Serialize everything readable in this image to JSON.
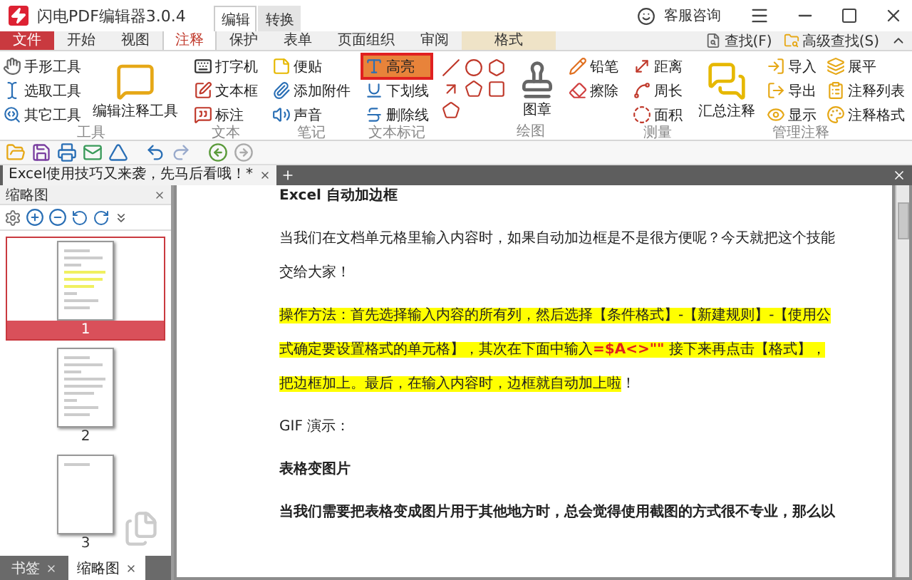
{
  "window": {
    "title": "闪电PDF编辑器3.0.4",
    "context_tabs": [
      {
        "label": "编辑",
        "selected": true
      },
      {
        "label": "转换",
        "selected": false
      }
    ],
    "support": "客服咨询"
  },
  "ribbon_tabs": [
    {
      "label": "文件",
      "kind": "file",
      "selected": false
    },
    {
      "label": "开始",
      "kind": "normal",
      "selected": false
    },
    {
      "label": "视图",
      "kind": "normal",
      "selected": false
    },
    {
      "label": "注释",
      "kind": "normal",
      "selected": true
    },
    {
      "label": "保护",
      "kind": "normal",
      "selected": false
    },
    {
      "label": "表单",
      "kind": "normal",
      "selected": false
    },
    {
      "label": "页面组织",
      "kind": "normal",
      "selected": false
    },
    {
      "label": "审阅",
      "kind": "normal",
      "selected": false
    },
    {
      "label": "格式",
      "kind": "context",
      "selected": false
    }
  ],
  "search": [
    "查找(F)",
    "高级查找(S)"
  ],
  "ribbon_groups": [
    {
      "label": "工具",
      "columns": [
        {
          "kind": "stack",
          "items": [
            {
              "label": "手形工具"
            },
            {
              "label": "选取工具"
            },
            {
              "label": "其它工具"
            }
          ]
        },
        {
          "kind": "large",
          "label": "编辑注释工具"
        }
      ]
    },
    {
      "label": "文本",
      "columns": [
        {
          "kind": "stack",
          "items": [
            {
              "label": "打字机"
            },
            {
              "label": "文本框"
            },
            {
              "label": "标注"
            }
          ]
        }
      ]
    },
    {
      "label": "笔记",
      "columns": [
        {
          "kind": "stack",
          "items": [
            {
              "label": "便贴"
            },
            {
              "label": "添加附件"
            },
            {
              "label": "声音"
            }
          ]
        }
      ]
    },
    {
      "label": "文本标记",
      "columns": [
        {
          "kind": "stack",
          "items": [
            {
              "label": "高亮",
              "selected": true
            },
            {
              "label": "下划线",
              "selected": false
            },
            {
              "label": "删除线",
              "selected": false
            }
          ]
        }
      ]
    },
    {
      "label": "绘图",
      "columns": [
        {
          "kind": "shapes"
        },
        {
          "kind": "large",
          "label": "图章"
        },
        {
          "kind": "stack",
          "items": [
            {
              "label": "铅笔"
            },
            {
              "label": "擦除"
            }
          ]
        }
      ]
    },
    {
      "label": "测量",
      "columns": [
        {
          "kind": "stack",
          "items": [
            {
              "label": "距离"
            },
            {
              "label": "周长"
            },
            {
              "label": "面积"
            }
          ]
        }
      ]
    },
    {
      "label": "管理注释",
      "columns": [
        {
          "kind": "large",
          "label": "汇总注释"
        },
        {
          "kind": "stack",
          "items": [
            {
              "label": "导入"
            },
            {
              "label": "导出"
            },
            {
              "label": "显示"
            }
          ]
        },
        {
          "kind": "stack",
          "items": [
            {
              "label": "展平"
            },
            {
              "label": "注释列表"
            },
            {
              "label": "注释格式"
            }
          ]
        }
      ]
    }
  ],
  "doc_tabs": [
    {
      "label": "Excel使用技巧又来袭，先马后看哦！*",
      "selected": true
    }
  ],
  "side_panel": {
    "title": "缩略图",
    "pages": [
      {
        "label": "1",
        "selected": true
      },
      {
        "label": "2",
        "selected": false
      },
      {
        "label": "3",
        "selected": false
      }
    ],
    "bottom_tabs": [
      {
        "label": "书签",
        "selected": false
      },
      {
        "label": "缩略图",
        "selected": true
      }
    ]
  },
  "document": [
    {
      "kind": "heading",
      "segments": [
        {
          "text": "Excel 自动加边框",
          "highlighted": false,
          "kind": "plain"
        }
      ]
    },
    {
      "kind": "text",
      "segments": [
        {
          "text": "当我们在文档单元格里输入内容时，如果自动加边框是不是很方便呢？今天就把这个技能交给大家！",
          "highlighted": false,
          "kind": "plain"
        }
      ]
    },
    {
      "kind": "text",
      "segments": [
        {
          "text": "操作方法：首先选择输入内容的所有列，然后选择【条件格式】-【新建规则】-【使用公式确定要设置格式的单元格】，其次在下面中输入",
          "highlighted": true,
          "kind": "plain"
        },
        {
          "text": "=$A<>\"\"",
          "highlighted": true,
          "kind": "formula"
        },
        {
          "text": "      接下来再点击【格式】，把边框加上。最后，在输入内容时，边框就自动加上啦",
          "highlighted": true,
          "kind": "plain"
        },
        {
          "text": "！",
          "highlighted": false,
          "kind": "plain"
        }
      ]
    },
    {
      "kind": "text",
      "segments": [
        {
          "text": "GIF 演示：",
          "highlighted": false,
          "kind": "plain"
        }
      ]
    },
    {
      "kind": "heading",
      "segments": [
        {
          "text": "表格变图片",
          "highlighted": false,
          "kind": "plain"
        }
      ]
    },
    {
      "kind": "heading",
      "segments": [
        {
          "text": "当我们需要把表格变成图片用于其他地方时，总会觉得使用截图的方式很不专业，那么以",
          "highlighted": false,
          "kind": "plain"
        }
      ]
    }
  ]
}
